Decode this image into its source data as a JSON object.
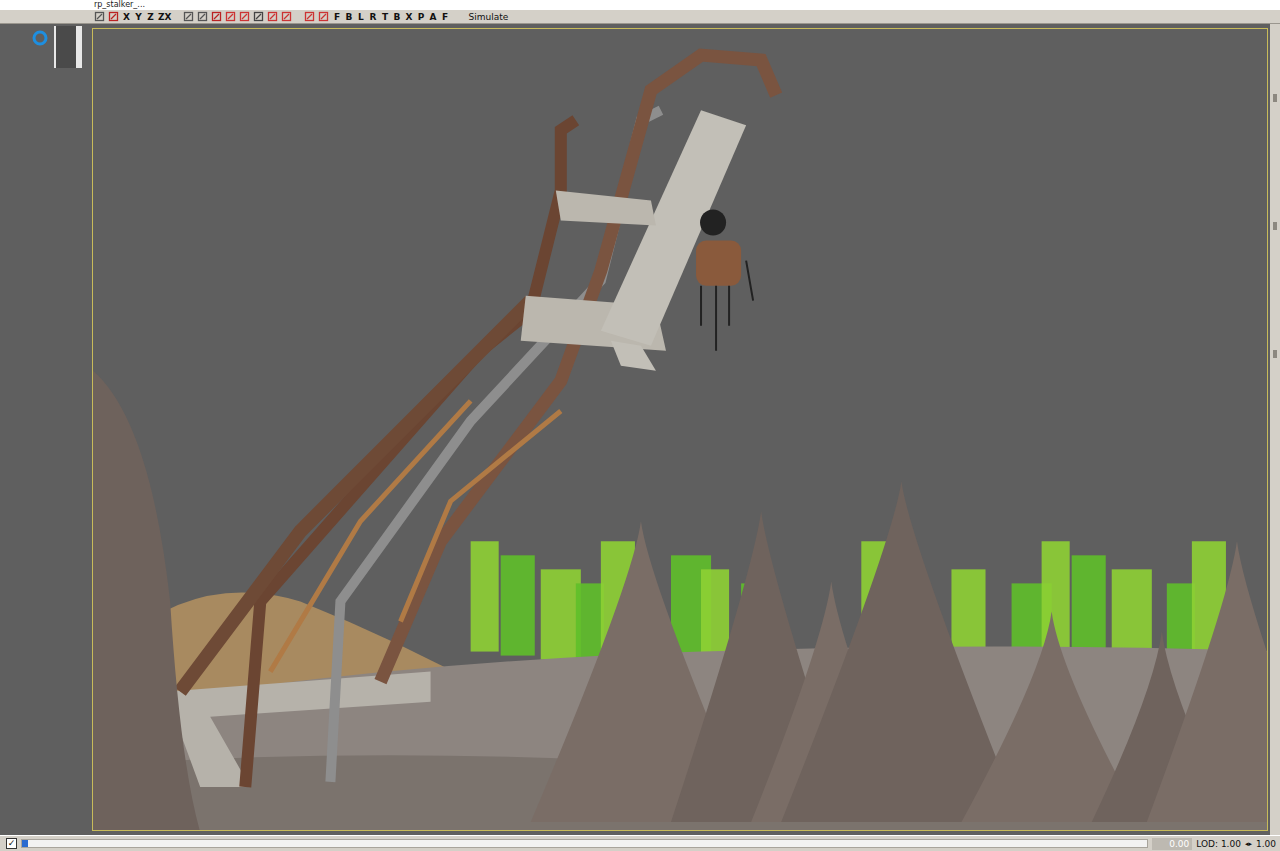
{
  "window": {
    "title": "rp_stalker_..."
  },
  "toolbar": {
    "axis_buttons": [
      "X",
      "Y",
      "Z",
      "ZX"
    ],
    "view_buttons": [
      "F",
      "B",
      "L",
      "R",
      "T",
      "B",
      "X"
    ],
    "mode_buttons": [
      "P",
      "A",
      "F"
    ],
    "simulate": "Simulate"
  },
  "status_bar": {
    "checked": true,
    "progress_level": 0.005,
    "time": "0.00",
    "lod": "LOD: 1.00",
    "scale": "1.00"
  }
}
